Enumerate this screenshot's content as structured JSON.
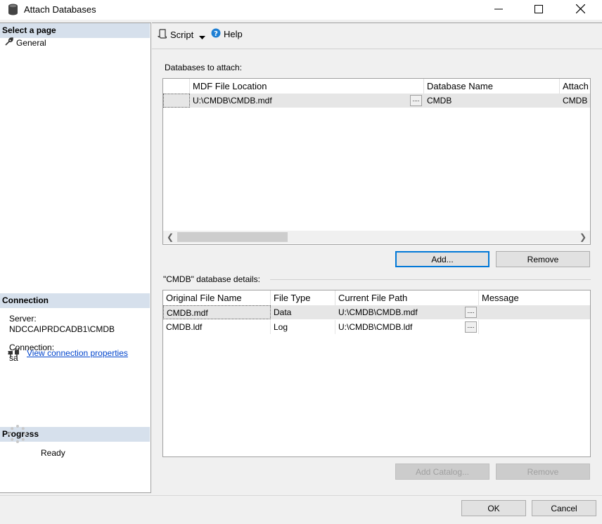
{
  "window": {
    "title": "Attach Databases"
  },
  "left": {
    "select_page_heading": "Select a page",
    "pages": [
      {
        "label": "General"
      }
    ],
    "connection_heading": "Connection",
    "server_label": "Server:",
    "server_value": "NDCCAIPRDCADB1\\CMDB",
    "connection_label": "Connection:",
    "connection_value": "sa",
    "view_connection_link": "View connection properties",
    "progress_heading": "Progress",
    "progress_status": "Ready"
  },
  "toolbar": {
    "script_label": "Script",
    "help_label": "Help"
  },
  "attach": {
    "group_label": "Databases to attach:",
    "columns": [
      "MDF File Location",
      "Database Name",
      "Attach As"
    ],
    "rows": [
      {
        "mdf": "U:\\CMDB\\CMDB.mdf",
        "db_name": "CMDB",
        "attach_as": "CMDB"
      }
    ],
    "ellipsis": "....",
    "add_button": "Add...",
    "remove_button": "Remove"
  },
  "details": {
    "group_label": "\"CMDB\" database details:",
    "columns": [
      "Original File Name",
      "File Type",
      "Current File Path",
      "Message"
    ],
    "rows": [
      {
        "name": "CMDB.mdf",
        "type": "Data",
        "path": "U:\\CMDB\\CMDB.mdf"
      },
      {
        "name": "CMDB.ldf",
        "type": "Log",
        "path": "U:\\CMDB\\CMDB.ldf"
      }
    ],
    "ellipsis": "....",
    "add_catalog_button": "Add Catalog...",
    "remove_button": "Remove"
  },
  "footer": {
    "ok_button": "OK",
    "cancel_button": "Cancel"
  },
  "colors": {
    "section_head": "#d6e0ec",
    "link": "#0044cc",
    "help_icon": "#1e7fd4",
    "default_border": "#0078d7"
  },
  "icons": [
    "database-icon",
    "minimize-icon",
    "maximize-icon",
    "close-icon",
    "wrench-icon",
    "plug-icon",
    "spinner-icon",
    "script-icon",
    "dropdown-icon",
    "help-icon"
  ]
}
